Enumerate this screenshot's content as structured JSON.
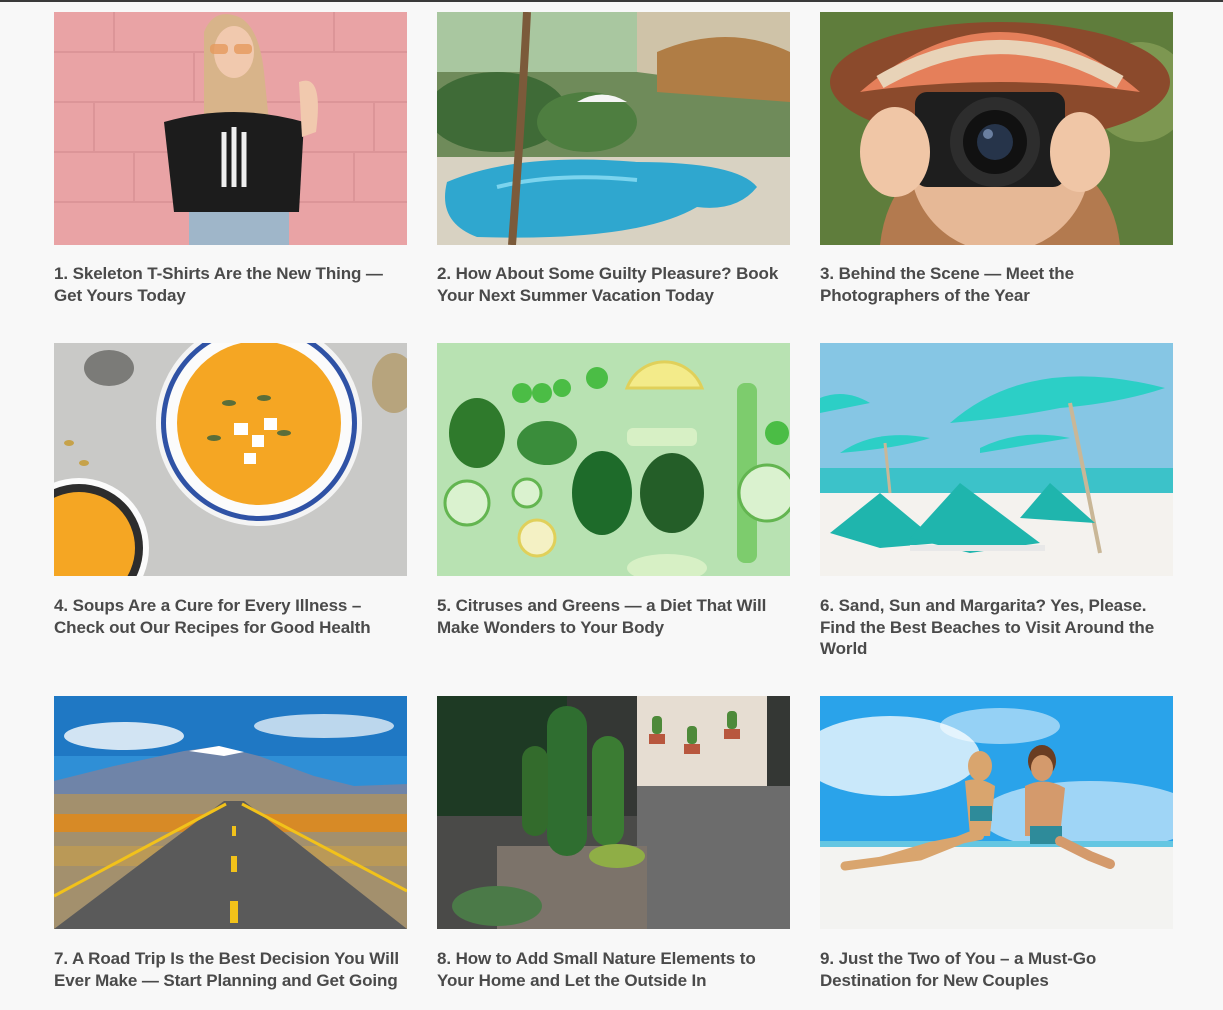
{
  "posts": [
    {
      "title": "1. Skeleton T-Shirts Are the New Thing — Get Yours Today",
      "image": "woman-skeleton-tshirt-pink-wall"
    },
    {
      "title": "2. How About Some Guilty Pleasure? Book Your Next Summer Vacation Today",
      "image": "resort-swimming-pool-palm"
    },
    {
      "title": "3. Behind the Scene — Meet the Photographers of the Year",
      "image": "woman-with-camera-hat"
    },
    {
      "title": "4. Soups Are a Cure for Every Illness – Check out Our Recipes for Good Health",
      "image": "pumpkin-soup-bowl"
    },
    {
      "title": "5. Citruses and Greens — a Diet That Will Make Wonders to Your Body",
      "image": "greens-citrus-flatlay"
    },
    {
      "title": "6. Sand, Sun and Margarita? Yes, Please. Find the Best Beaches to Visit Around the World",
      "image": "beach-umbrellas-loungers"
    },
    {
      "title": "7. A Road Trip Is the Best Decision You Will Ever Make — Start Planning and Get Going",
      "image": "desert-road-mountains"
    },
    {
      "title": "8. How to Add Small Nature Elements to Your Home and Let the Outside In",
      "image": "cactus-home-decor"
    },
    {
      "title": "9. Just the Two of You – a Must-Go Destination for New Couples",
      "image": "couple-on-beach"
    }
  ]
}
